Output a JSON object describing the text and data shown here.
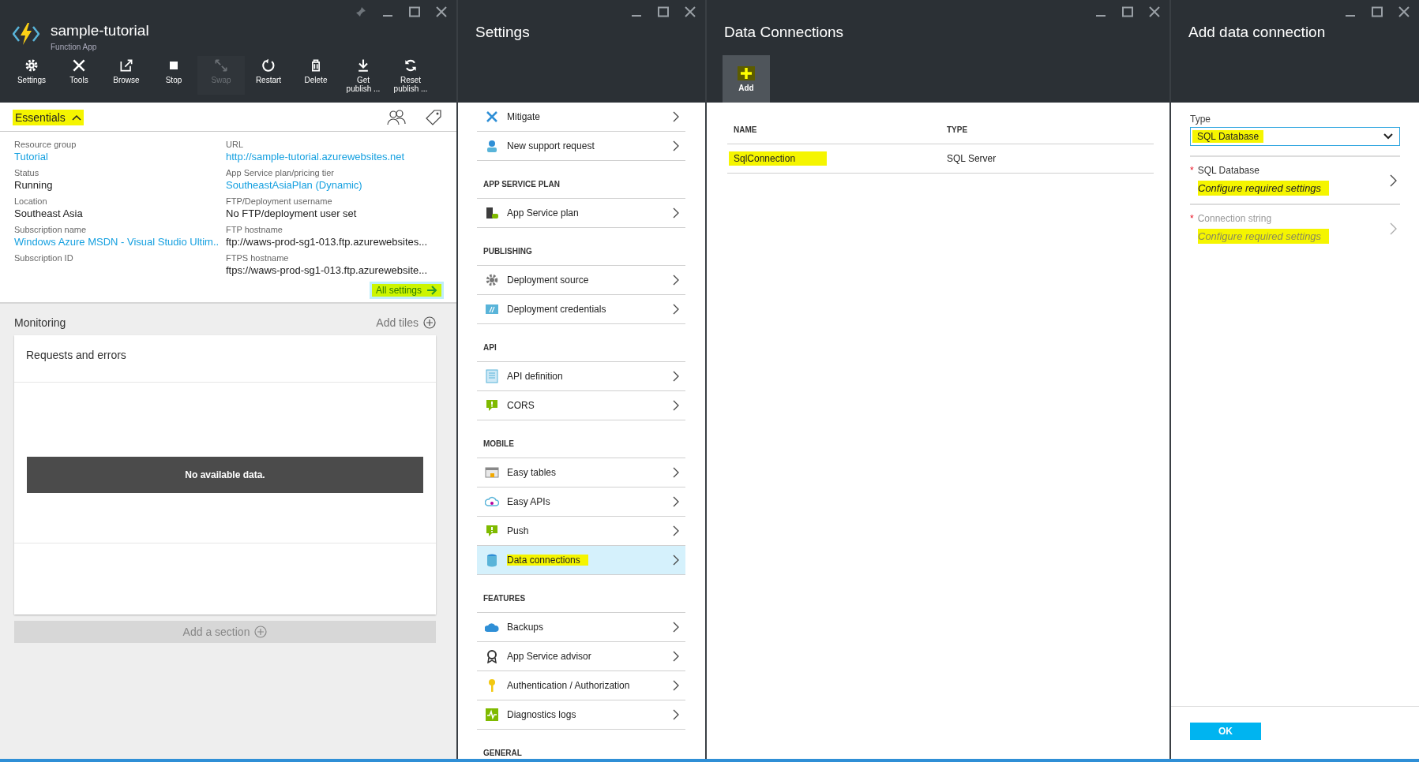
{
  "app_blade": {
    "title": "sample-tutorial",
    "subtitle": "Function App",
    "toolbar": [
      {
        "label": "Settings",
        "kind": "gear",
        "disabled": false
      },
      {
        "label": "Tools",
        "kind": "tools",
        "disabled": false
      },
      {
        "label": "Browse",
        "kind": "browse",
        "disabled": false
      },
      {
        "label": "Stop",
        "kind": "stop",
        "disabled": false
      },
      {
        "label": "Swap",
        "kind": "swap",
        "disabled": true
      },
      {
        "label": "Restart",
        "kind": "restart",
        "disabled": false
      },
      {
        "label": "Delete",
        "kind": "delete",
        "disabled": false
      },
      {
        "label": "Get publish ...",
        "kind": "download",
        "disabled": false
      },
      {
        "label": "Reset publish ...",
        "kind": "reset",
        "disabled": false
      }
    ],
    "essentials": {
      "title": "Essentials",
      "highlighted": true,
      "expanded": true,
      "left": [
        {
          "label": "Resource group",
          "value": "Tutorial",
          "link": true
        },
        {
          "label": "Status",
          "value": "Running",
          "link": false
        },
        {
          "label": "Location",
          "value": "Southeast Asia",
          "link": false
        },
        {
          "label": "Subscription name",
          "value": "Windows Azure MSDN - Visual Studio Ultim..",
          "link": true
        },
        {
          "label": "Subscription ID"
        }
      ],
      "right": [
        {
          "label": "URL",
          "value": "http://sample-tutorial.azurewebsites.net",
          "link": true
        },
        {
          "label": "App Service plan/pricing tier",
          "value": "SoutheastAsiaPlan (Dynamic)",
          "link": true
        },
        {
          "label": "FTP/Deployment username",
          "value": "No FTP/deployment user set",
          "link": false
        },
        {
          "label": "FTP hostname",
          "value": "ftp://waws-prod-sg1-013.ftp.azurewebsites...",
          "link": false
        },
        {
          "label": "FTPS hostname",
          "value": "ftps://waws-prod-sg1-013.ftp.azurewebsite...",
          "link": false
        }
      ],
      "all_settings": {
        "label": "All settings",
        "highlighted": true
      }
    },
    "monitoring": {
      "title": "Monitoring",
      "add_tiles": "Add tiles",
      "tile_title": "Requests and errors",
      "empty_message": "No available data.",
      "add_section": "Add a section"
    }
  },
  "settings_blade": {
    "title": "Settings",
    "groups": [
      {
        "items": [
          {
            "label": "Mitigate",
            "kind": "mitigate",
            "selected": false,
            "highlighted": false
          },
          {
            "label": "New support request",
            "kind": "support",
            "selected": false,
            "highlighted": false
          }
        ]
      },
      {
        "heading": "APP SERVICE PLAN",
        "items": [
          {
            "label": "App Service plan",
            "kind": "plan",
            "selected": false,
            "highlighted": false
          }
        ]
      },
      {
        "heading": "PUBLISHING",
        "items": [
          {
            "label": "Deployment source",
            "kind": "gear",
            "selected": false,
            "highlighted": false
          },
          {
            "label": "Deployment credentials",
            "kind": "credentials",
            "selected": false,
            "highlighted": false
          }
        ]
      },
      {
        "heading": "API",
        "items": [
          {
            "label": "API definition",
            "kind": "api",
            "selected": false,
            "highlighted": false
          },
          {
            "label": "CORS",
            "kind": "bubble",
            "selected": false,
            "highlighted": false
          }
        ]
      },
      {
        "heading": "MOBILE",
        "items": [
          {
            "label": "Easy tables",
            "kind": "tables",
            "selected": false,
            "highlighted": false
          },
          {
            "label": "Easy APIs",
            "kind": "cloud",
            "selected": false,
            "highlighted": false
          },
          {
            "label": "Push",
            "kind": "bubble",
            "selected": false,
            "highlighted": false
          },
          {
            "label": "Data connections",
            "kind": "db",
            "selected": true,
            "highlighted": true
          }
        ]
      },
      {
        "heading": "FEATURES",
        "items": [
          {
            "label": "Backups",
            "kind": "backups",
            "selected": false,
            "highlighted": false
          },
          {
            "label": "App Service advisor",
            "kind": "ribbon",
            "selected": false,
            "highlighted": false
          },
          {
            "label": "Authentication / Authorization",
            "kind": "key",
            "selected": false,
            "highlighted": false
          },
          {
            "label": "Diagnostics logs",
            "kind": "logs",
            "selected": false,
            "highlighted": false
          }
        ]
      },
      {
        "heading": "GENERAL"
      }
    ]
  },
  "connections_blade": {
    "title": "Data Connections",
    "add": {
      "label": "Add",
      "highlighted": true
    },
    "table": {
      "columns": [
        "NAME",
        "TYPE"
      ],
      "rows": [
        {
          "cells": [
            "SqlConnection",
            "SQL Server"
          ],
          "highlighted": true
        }
      ]
    }
  },
  "add_blade": {
    "title": "Add data connection",
    "type_label": "Type",
    "type_value": {
      "text": "SQL Database",
      "highlighted": true
    },
    "fields": [
      {
        "label": "SQL Database",
        "value": "Configure required settings",
        "required_mark": "*",
        "disabled": false,
        "highlighted": true
      },
      {
        "label": "Connection string",
        "value": "Configure required settings",
        "required_mark": "*",
        "disabled": true,
        "highlighted": true
      }
    ],
    "ok": "OK"
  }
}
